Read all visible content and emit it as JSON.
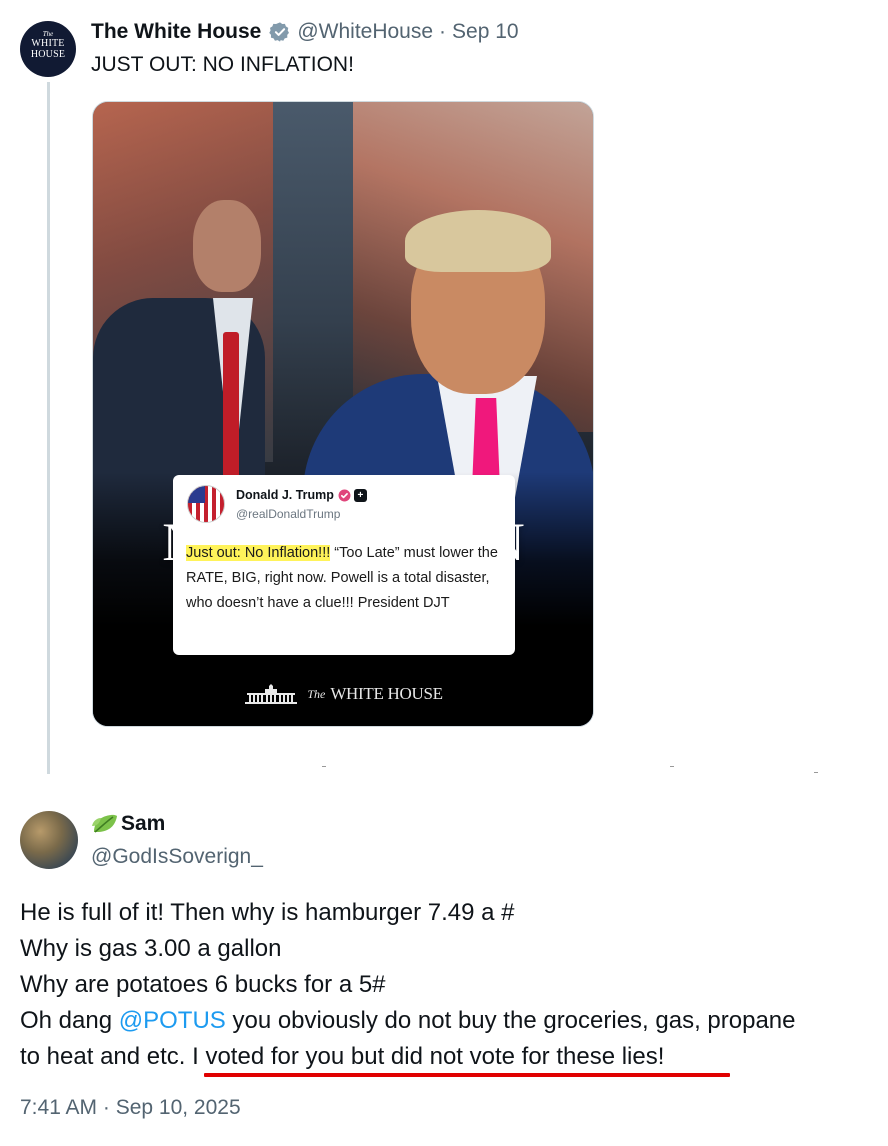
{
  "parent_tweet": {
    "avatar": {
      "line1": "The",
      "line2": "WHITE",
      "line3": "HOUSE"
    },
    "name": "The White House",
    "handle": "@WhiteHouse",
    "date": "Sep 10",
    "text": "JUST OUT: NO INFLATION!",
    "media": {
      "headline": "NO INFLATION",
      "embedded_post": {
        "name": "Donald J. Trump",
        "handle": "@realDonaldTrump",
        "highlight": "Just out: No Inflation!!!",
        "body": " “Too Late” must lower the RATE, BIG, right now. Powell is a total disaster, who doesn’t have a clue!!! President DJT"
      },
      "footer": {
        "the": "The",
        "name": "WHITE HOUSE"
      }
    }
  },
  "reply": {
    "name": "Sam",
    "handle": "@GodIsSoverign_",
    "lines": [
      "He is full of it! Then why is hamburger 7.49 a #",
      "Why is gas 3.00 a gallon",
      "Why are potatoes 6 bucks for a 5#"
    ],
    "line4_pre": "Oh dang ",
    "mention": "@POTUS",
    "line4_post": " you obviously do not buy the groceries, gas, propane",
    "line5": "to heat and etc. I voted for you but did not vote for these lies!",
    "timestamp": "7:41 AM · Sep 10, 2025"
  },
  "colors": {
    "verified": "#829aab",
    "mention": "#1d9bf0",
    "underline": "#e00000"
  },
  "icons": [
    "verified-badge-icon",
    "leaf-emoji-icon",
    "white-house-building-icon"
  ]
}
